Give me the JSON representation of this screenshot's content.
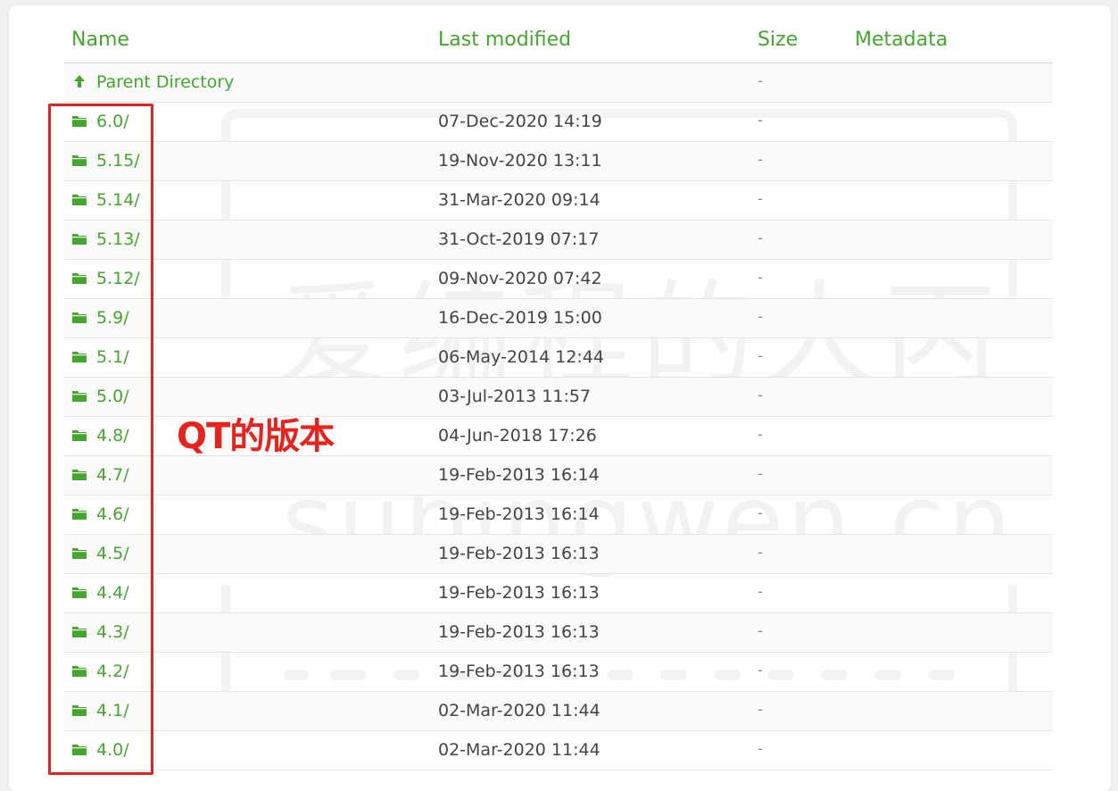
{
  "header": {
    "name": "Name",
    "last_modified": "Last modified",
    "size": "Size",
    "metadata": "Metadata"
  },
  "parent": {
    "label": "Parent Directory",
    "size": "-"
  },
  "rows": [
    {
      "name": "6.0/",
      "modified": "07-Dec-2020 14:19",
      "size": "-"
    },
    {
      "name": "5.15/",
      "modified": "19-Nov-2020 13:11",
      "size": "-"
    },
    {
      "name": "5.14/",
      "modified": "31-Mar-2020 09:14",
      "size": "-"
    },
    {
      "name": "5.13/",
      "modified": "31-Oct-2019 07:17",
      "size": "-"
    },
    {
      "name": "5.12/",
      "modified": "09-Nov-2020 07:42",
      "size": "-"
    },
    {
      "name": "5.9/",
      "modified": "16-Dec-2019 15:00",
      "size": "-"
    },
    {
      "name": "5.1/",
      "modified": "06-May-2014 12:44",
      "size": "-"
    },
    {
      "name": "5.0/",
      "modified": "03-Jul-2013 11:57",
      "size": "-"
    },
    {
      "name": "4.8/",
      "modified": "04-Jun-2018 17:26",
      "size": "-"
    },
    {
      "name": "4.7/",
      "modified": "19-Feb-2013 16:14",
      "size": "-"
    },
    {
      "name": "4.6/",
      "modified": "19-Feb-2013 16:14",
      "size": "-"
    },
    {
      "name": "4.5/",
      "modified": "19-Feb-2013 16:13",
      "size": "-"
    },
    {
      "name": "4.4/",
      "modified": "19-Feb-2013 16:13",
      "size": "-"
    },
    {
      "name": "4.3/",
      "modified": "19-Feb-2013 16:13",
      "size": "-"
    },
    {
      "name": "4.2/",
      "modified": "19-Feb-2013 16:13",
      "size": "-"
    },
    {
      "name": "4.1/",
      "modified": "02-Mar-2020 11:44",
      "size": "-"
    },
    {
      "name": "4.0/",
      "modified": "02-Mar-2020 11:44",
      "size": "-"
    }
  ],
  "annotation": "QT的版本",
  "watermark": {
    "cn": "爱编程的大丙",
    "en": "subingwen.cn"
  },
  "colors": {
    "link": "#43a72b",
    "annotation": "#e8231c",
    "box": "#e02424"
  },
  "icons": {
    "parent": "arrow-up-icon",
    "folder": "folder-icon"
  }
}
